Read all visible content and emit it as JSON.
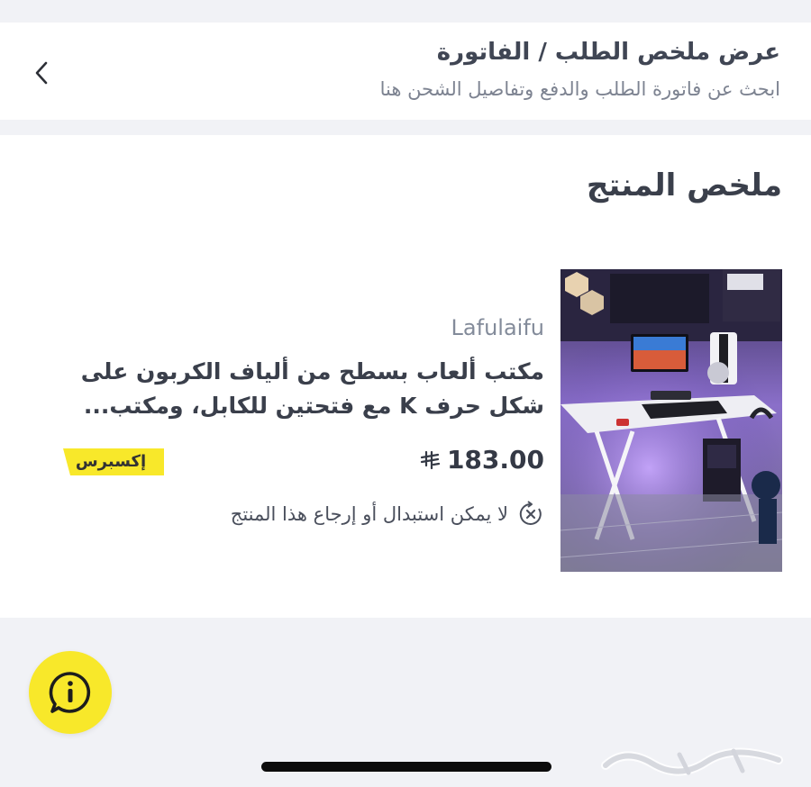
{
  "header": {
    "title": "عرض ملخص الطلب / الفاتورة",
    "subtitle": "ابحث عن فاتورة الطلب والدفع وتفاصيل الشحن هنا",
    "back_icon": "chevron-left-icon"
  },
  "summary": {
    "section_title": "ملخص المنتج",
    "product": {
      "brand": "Lafulaifu",
      "name": "مكتب ألعاب بسطح من ألياف الكربون على شكل حرف K مع فتحتين للكابل، ومكتب...",
      "price": "183.00",
      "currency_icon": "riyal-symbol-icon",
      "badge": "إكسبرس",
      "return_policy": "لا يمكن استبدال أو إرجاع هذا المنتج",
      "return_icon": "no-return-icon"
    }
  },
  "help": {
    "icon": "info-chat-icon"
  },
  "colors": {
    "accent_yellow": "#f8e82a",
    "text_dark": "#3a3f4b",
    "text_muted": "#7d8391",
    "background": "#f1f2f6"
  }
}
